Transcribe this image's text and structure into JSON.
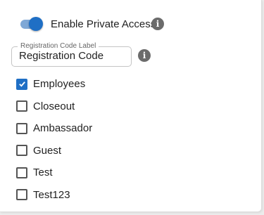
{
  "private_access": {
    "label": "Enable Private Access",
    "enabled": true,
    "info_icon": "info-icon"
  },
  "registration_code": {
    "label": "Registration Code Label",
    "value": "Registration Code",
    "info_icon": "info-icon"
  },
  "checkboxes": [
    {
      "label": "Employees",
      "checked": true
    },
    {
      "label": "Closeout",
      "checked": false
    },
    {
      "label": "Ambassador",
      "checked": false
    },
    {
      "label": "Guest",
      "checked": false
    },
    {
      "label": "Test",
      "checked": false
    },
    {
      "label": "Test123",
      "checked": false
    }
  ],
  "colors": {
    "accent": "#1f6fc5",
    "toggle_track": "#7fa8d6",
    "icon_gray": "#6b6b6b"
  }
}
